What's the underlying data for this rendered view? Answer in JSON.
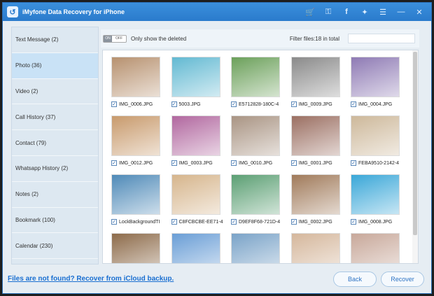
{
  "window": {
    "title": "iMyfone Data Recovery for iPhone"
  },
  "titlebar_icons": [
    "cart-icon",
    "user-key-icon",
    "facebook-icon",
    "twitter-icon",
    "menu-icon",
    "minimize-icon",
    "close-icon"
  ],
  "sidebar": {
    "items": [
      {
        "label": "Text Message  (2)"
      },
      {
        "label": "Photo  (36)"
      },
      {
        "label": "Video  (2)"
      },
      {
        "label": "Call History  (37)"
      },
      {
        "label": "Contact  (79)"
      },
      {
        "label": "Whatsapp History  (2)"
      },
      {
        "label": "Notes  (2)"
      },
      {
        "label": "Bookmark  (100)"
      },
      {
        "label": "Calendar  (230)"
      }
    ],
    "active_index": 1
  },
  "toolbar": {
    "toggle_on": "ON",
    "toggle_off": "OFF",
    "only_deleted_label": "Only show the deleted",
    "filter_label": "Filter files:18 in total",
    "filter_value": ""
  },
  "photos": [
    {
      "name": "IMG_0006.JPG",
      "checked": true,
      "color": "#b7916f"
    },
    {
      "name": "5003.JPG",
      "checked": true,
      "color": "#62b9d2"
    },
    {
      "name": "E5712828-180C-4",
      "checked": true,
      "color": "#6ba05a"
    },
    {
      "name": "IMG_0009.JPG",
      "checked": true,
      "color": "#8a8a8a"
    },
    {
      "name": "IMG_0004.JPG",
      "checked": true,
      "color": "#8e7ab4"
    },
    {
      "name": "IMG_0012.JPG",
      "checked": true,
      "color": "#c89a6c"
    },
    {
      "name": "IMG_0003.JPG",
      "checked": true,
      "color": "#b1679f"
    },
    {
      "name": "IMG_0010.JPG",
      "checked": true,
      "color": "#a99483"
    },
    {
      "name": "IMG_0001.JPG",
      "checked": true,
      "color": "#9b6f62"
    },
    {
      "name": "FEBA9510-2142-4",
      "checked": true,
      "color": "#cdb89a"
    },
    {
      "name": "LockBackgroundTI",
      "checked": true,
      "color": "#4f8ab8"
    },
    {
      "name": "C8FCBCBE-EE71-4",
      "checked": true,
      "color": "#d6b58c"
    },
    {
      "name": "D9EF8F68-721D-4",
      "checked": true,
      "color": "#5b9f73"
    },
    {
      "name": "IMG_0002.JPG",
      "checked": true,
      "color": "#a07a5a"
    },
    {
      "name": "IMG_0008.JPG",
      "checked": true,
      "color": "#3aa7d8"
    },
    {
      "name": "",
      "checked": false,
      "color": "#8d6b4a"
    },
    {
      "name": "",
      "checked": false,
      "color": "#6a9ed6"
    },
    {
      "name": "",
      "checked": false,
      "color": "#7aa3c8"
    },
    {
      "name": "",
      "checked": false,
      "color": "#d5b79c"
    },
    {
      "name": "",
      "checked": false,
      "color": "#c8a89a"
    }
  ],
  "footer": {
    "icloud_link": "Files are not found? Recover from iCloud backup.",
    "back_label": "Back",
    "recover_label": "Recover"
  }
}
